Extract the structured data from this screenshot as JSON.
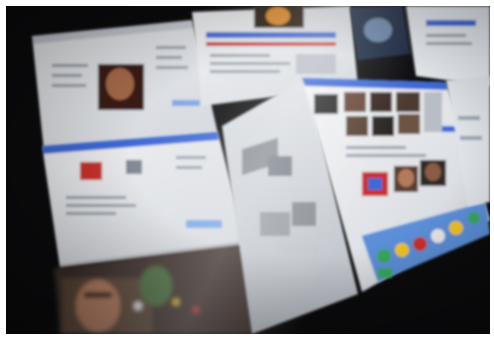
{
  "photo": {
    "subject": "",
    "colors": {
      "background": "#0a0a0c",
      "panel": "#e9ebee",
      "panel_dark": "#cfd3d9",
      "blue_bar": "#3d6bd6",
      "blue_light": "#7aa6e6",
      "red": "#c8302a",
      "yellow": "#f0c420",
      "green": "#3aa85a",
      "skin": "#b47a5c"
    }
  }
}
